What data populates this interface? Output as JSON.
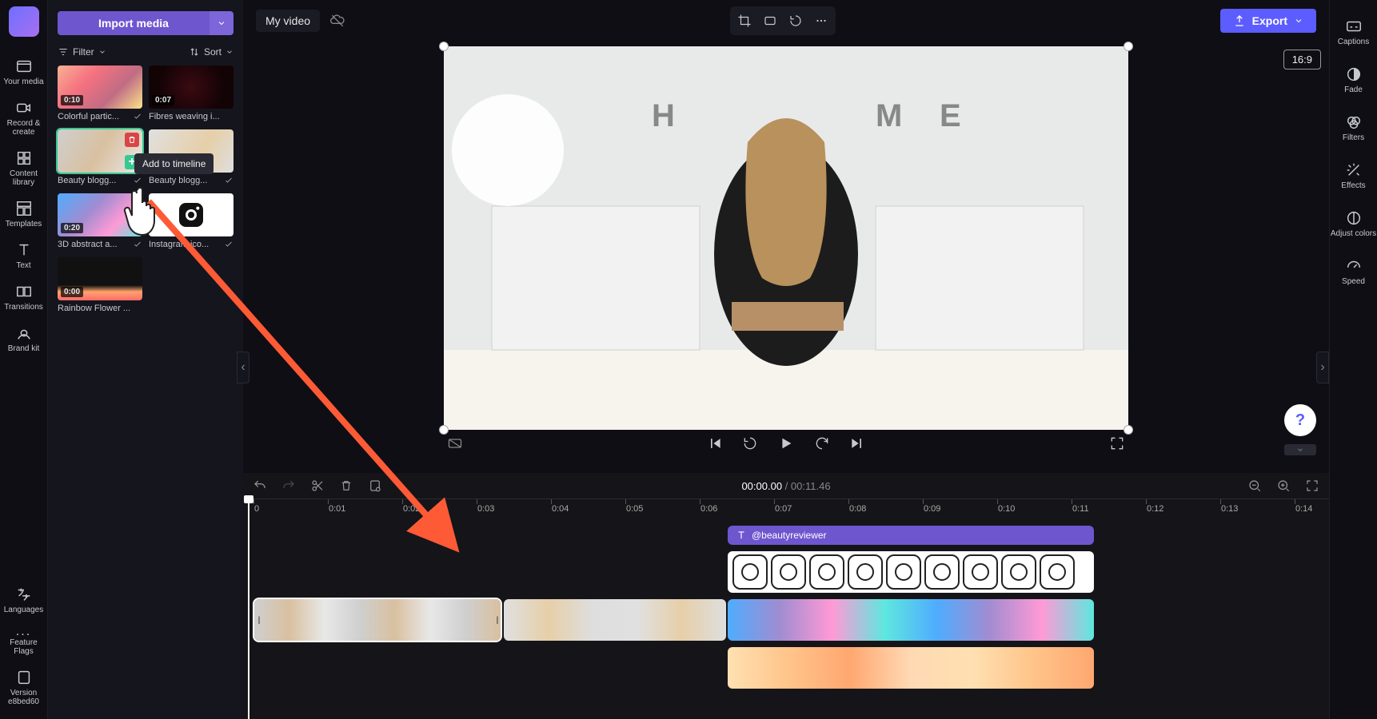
{
  "left_rail": {
    "items": [
      "Your media",
      "Record & create",
      "Content library",
      "Templates",
      "Text",
      "Transitions",
      "Brand kit"
    ],
    "bottom": [
      "Languages",
      "...",
      "Feature Flags",
      "Version e8bed60"
    ]
  },
  "media": {
    "import_label": "Import media",
    "filter_label": "Filter",
    "sort_label": "Sort",
    "tooltip": "Add to timeline",
    "clips": [
      {
        "name": "Colorful partic...",
        "dur": "0:10"
      },
      {
        "name": "Fibres weaving i...",
        "dur": "0:07"
      },
      {
        "name": "Beauty blogg...",
        "dur": ""
      },
      {
        "name": "Beauty blogg...",
        "dur": ""
      },
      {
        "name": "3D abstract a...",
        "dur": "0:20"
      },
      {
        "name": "Instagram ico...",
        "dur": ""
      },
      {
        "name": "Rainbow Flower ...",
        "dur": "0:00"
      }
    ]
  },
  "topbar": {
    "title": "My video",
    "export": "Export",
    "aspect": "16:9"
  },
  "right_rail": {
    "items": [
      "Captions",
      "Fade",
      "Filters",
      "Effects",
      "Adjust colors",
      "Speed"
    ]
  },
  "timeline": {
    "time_current": "00:00.00",
    "time_total": "00:11.46",
    "ruler": [
      "0",
      "0:01",
      "0:02",
      "0:03",
      "0:04",
      "0:05",
      "0:06",
      "0:07",
      "0:08",
      "0:09",
      "0:10",
      "0:11",
      "0:12",
      "0:13",
      "0:14"
    ],
    "text_clip": "@beautyreviewer"
  },
  "help": "?"
}
